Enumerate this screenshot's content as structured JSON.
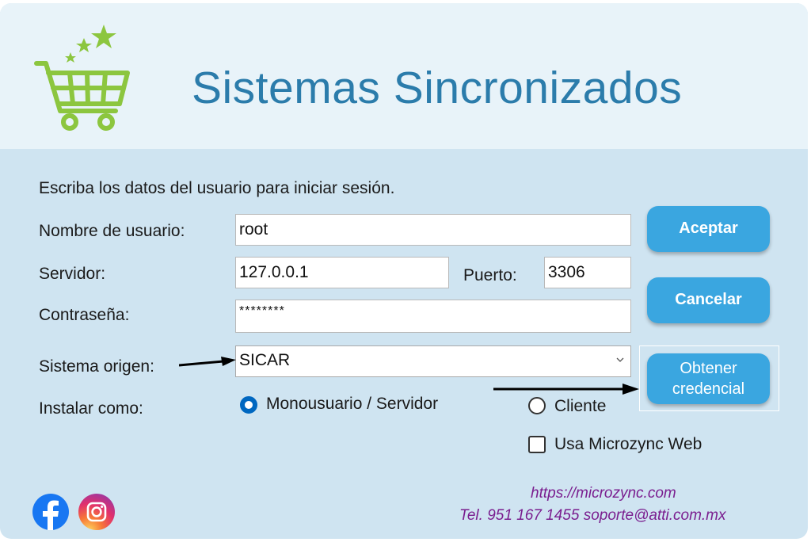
{
  "header": {
    "brand_title": "Sistemas Sincronizados"
  },
  "form": {
    "instructions": "Escriba los datos del usuario para iniciar sesión.",
    "username_label": "Nombre de usuario:",
    "username_value": "root",
    "server_label": "Servidor:",
    "server_value": "127.0.0.1",
    "port_label": "Puerto:",
    "port_value": "3306",
    "password_label": "Contraseña:",
    "password_value": "********",
    "system_label": "Sistema origen:",
    "system_value": "SICAR",
    "install_label": "Instalar como:",
    "install_options": [
      {
        "label": "Monousuario / Servidor",
        "selected": true
      },
      {
        "label": "Cliente",
        "selected": false
      }
    ],
    "web_checkbox_label": "Usa Microzync Web",
    "web_checkbox_checked": false
  },
  "buttons": {
    "accept": "Aceptar",
    "cancel": "Cancelar",
    "credential_line1": "Obtener",
    "credential_line2": "credencial"
  },
  "footer": {
    "website": "https://microzync.com",
    "contact": "Tel. 951 167 1455  soporte@atti.com.mx",
    "social_icons": [
      "facebook-icon",
      "instagram-icon"
    ]
  },
  "colors": {
    "accent": "#3aa6e0",
    "brand_text": "#2b7cab",
    "logo_green": "#8cc63f",
    "link_purple": "#7a1e8f",
    "panel_bg": "#cfe4f1",
    "header_bg": "#e8f3f9"
  }
}
